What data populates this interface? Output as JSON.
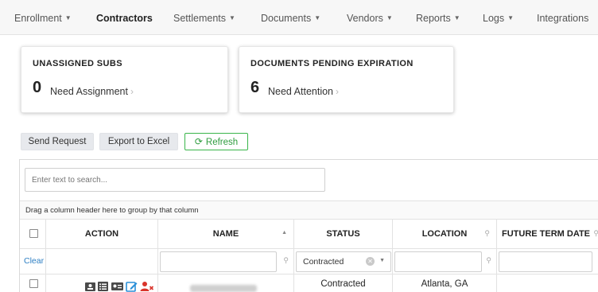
{
  "nav": {
    "items": [
      {
        "label": "Enrollment",
        "dropdown": true
      },
      {
        "label": "Contractors",
        "dropdown": false,
        "active": true
      },
      {
        "label": "Settlements",
        "dropdown": true
      },
      {
        "label": "Documents",
        "dropdown": true
      },
      {
        "label": "Vendors",
        "dropdown": true
      },
      {
        "label": "Reports",
        "dropdown": true
      },
      {
        "label": "Logs",
        "dropdown": true
      },
      {
        "label": "Integrations",
        "dropdown": false
      }
    ]
  },
  "cards": {
    "unassigned": {
      "title": "UNASSIGNED SUBS",
      "count": "0",
      "subtitle": "Need Assignment"
    },
    "pending": {
      "title": "DOCUMENTS PENDING EXPIRATION",
      "count": "6",
      "subtitle": "Need Attention"
    }
  },
  "toolbar": {
    "send_request": "Send Request",
    "export_excel": "Export to Excel",
    "refresh": "Refresh"
  },
  "grid": {
    "search_placeholder": "Enter text to search...",
    "group_hint": "Drag a column header here to group by that column",
    "columns": {
      "action": "ACTION",
      "name": "NAME",
      "status": "STATUS",
      "location": "LOCATION",
      "future_term_date": "FUTURE TERM DATE"
    },
    "filter": {
      "clear": "Clear",
      "status_value": "Contracted"
    },
    "rows": [
      {
        "status": "Contracted",
        "location": "Atlanta, GA"
      }
    ]
  },
  "colors": {
    "accent_green": "#39b54a",
    "link_blue": "#2d7fc3",
    "icon_red": "#d9342b",
    "icon_blue": "#2a8fd8"
  },
  "icons": [
    "chevron-right-icon",
    "refresh-icon",
    "sort-icon",
    "pin-icon",
    "id-card-icon",
    "list-icon",
    "id-badge-icon",
    "edit-icon",
    "remove-user-icon"
  ]
}
